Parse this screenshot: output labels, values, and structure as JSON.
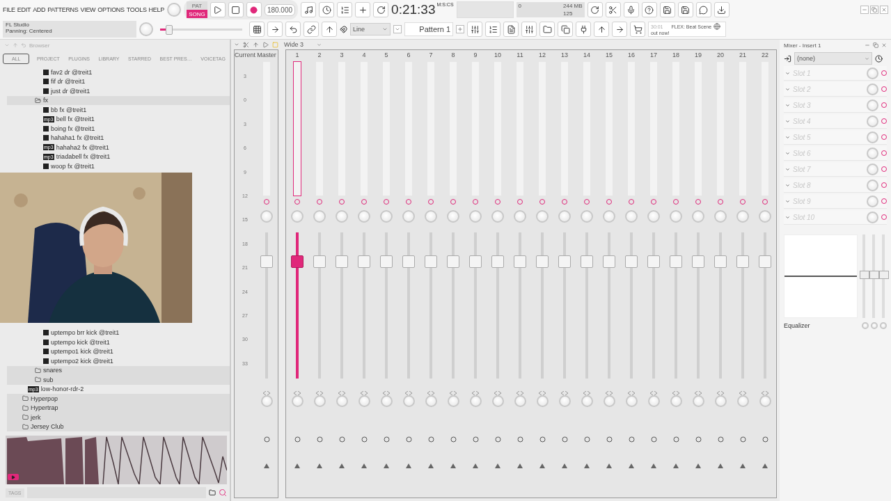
{
  "menu": [
    "FILE",
    "EDIT",
    "ADD",
    "PATTERNS",
    "VIEW",
    "OPTIONS",
    "TOOLS",
    "HELP"
  ],
  "hint": {
    "title": "FL Studio",
    "text": "Panning: Centered"
  },
  "transport": {
    "modes": [
      {
        "label": "PAT",
        "selected": false
      },
      {
        "label": "SONG",
        "selected": true
      }
    ],
    "tempo": "180.000"
  },
  "time": {
    "value": "0:21:33",
    "unit": "M:S:CS"
  },
  "master_pitch": {
    "level": 0.1
  },
  "memory": {
    "cpu": "0",
    "ram": "244 MB",
    "polyphony": "125"
  },
  "snap": "Line",
  "pattern": "Pattern 1",
  "news": {
    "time": "30:01",
    "title": "FLEX: Beat Scene",
    "text": "out now!"
  },
  "browser": {
    "title": "Browser",
    "tabs": [
      {
        "label": "ALL",
        "selected": true
      },
      {
        "label": "PROJECT",
        "selected": false
      },
      {
        "label": "PLUGINS",
        "selected": false
      },
      {
        "label": "LIBRARY",
        "selected": false
      },
      {
        "label": "STARRED",
        "selected": false
      },
      {
        "label": "BEST PRES…",
        "selected": false
      },
      {
        "label": "VOICETAG",
        "selected": false
      }
    ],
    "tree_upper": [
      {
        "kind": "file",
        "label": "fav2 dr @treit1"
      },
      {
        "kind": "file",
        "label": "fif dr @treit1"
      },
      {
        "kind": "file",
        "label": "just dr @treit1"
      },
      {
        "kind": "folder",
        "label": "fx",
        "expanded": true,
        "children": [
          {
            "kind": "file",
            "label": "bb fx @treit1"
          },
          {
            "kind": "file",
            "label": "bell fx @treit1",
            "badge": "mp3"
          },
          {
            "kind": "file",
            "label": "boing fx @treit1"
          },
          {
            "kind": "file",
            "label": "hahaha1 fx @treit1"
          },
          {
            "kind": "file",
            "label": "hahaha2 fx @treit1",
            "badge": "mp3"
          },
          {
            "kind": "file",
            "label": "triadabell fx @treit1",
            "badge": "mp3"
          },
          {
            "kind": "file",
            "label": "woop fx @treit1"
          }
        ]
      }
    ],
    "tree_lower": [
      {
        "kind": "files",
        "items": [
          {
            "kind": "file",
            "label": "uptempo brr kick @treit1"
          },
          {
            "kind": "file",
            "label": "uptempo kick @treit1"
          },
          {
            "kind": "file",
            "label": "uptempo1 kick @treit1"
          },
          {
            "kind": "file",
            "label": "uptempo2 kick @treit1"
          }
        ]
      },
      {
        "kind": "subfolders",
        "items": [
          {
            "kind": "folder",
            "label": "snares",
            "expanded": false
          },
          {
            "kind": "folder",
            "label": "sub",
            "expanded": false
          }
        ]
      },
      {
        "kind": "samples",
        "items": [
          {
            "kind": "file",
            "label": "low-honor-rdr-2",
            "badge": "mp3"
          }
        ]
      },
      {
        "kind": "genres",
        "items": [
          {
            "kind": "folder",
            "label": "Hyperpop",
            "expanded": false
          },
          {
            "kind": "folder",
            "label": "Hypertrap",
            "expanded": false
          },
          {
            "kind": "folder",
            "label": "jerk",
            "expanded": false
          },
          {
            "kind": "folder",
            "label": "Jersey Club",
            "expanded": false
          }
        ]
      }
    ],
    "tags": "TAGS"
  },
  "mixer": {
    "preset": "Wide 3",
    "current": "Current",
    "scale": [
      "3",
      "0",
      "3",
      "6",
      "9",
      "12",
      "15",
      "18",
      "21",
      "24",
      "27",
      "30",
      "33"
    ],
    "tracks": [
      {
        "label": "Master",
        "selected": false,
        "level": 0.8
      },
      {
        "label": "1",
        "selected": true,
        "level": 0.8
      },
      {
        "label": "2",
        "selected": false,
        "level": 0.8
      },
      {
        "label": "3",
        "selected": false,
        "level": 0.8
      },
      {
        "label": "4",
        "selected": false,
        "level": 0.8
      },
      {
        "label": "5",
        "selected": false,
        "level": 0.8
      },
      {
        "label": "6",
        "selected": false,
        "level": 0.8
      },
      {
        "label": "7",
        "selected": false,
        "level": 0.8
      },
      {
        "label": "8",
        "selected": false,
        "level": 0.8
      },
      {
        "label": "9",
        "selected": false,
        "level": 0.8
      },
      {
        "label": "10",
        "selected": false,
        "level": 0.8
      },
      {
        "label": "11",
        "selected": false,
        "level": 0.8
      },
      {
        "label": "12",
        "selected": false,
        "level": 0.8
      },
      {
        "label": "13",
        "selected": false,
        "level": 0.8
      },
      {
        "label": "14",
        "selected": false,
        "level": 0.8
      },
      {
        "label": "15",
        "selected": false,
        "level": 0.8
      },
      {
        "label": "16",
        "selected": false,
        "level": 0.8
      },
      {
        "label": "17",
        "selected": false,
        "level": 0.8
      },
      {
        "label": "18",
        "selected": false,
        "level": 0.8
      },
      {
        "label": "19",
        "selected": false,
        "level": 0.8
      },
      {
        "label": "20",
        "selected": false,
        "level": 0.8
      },
      {
        "label": "21",
        "selected": false,
        "level": 0.8
      },
      {
        "label": "22",
        "selected": false,
        "level": 0.8
      }
    ]
  },
  "insert_panel": {
    "title": "Mixer - Insert 1",
    "input": "(none)",
    "slots": [
      "Slot 1",
      "Slot 2",
      "Slot 3",
      "Slot 4",
      "Slot 5",
      "Slot 6",
      "Slot 7",
      "Slot 8",
      "Slot 9",
      "Slot 10"
    ],
    "effect": "Equalizer"
  }
}
